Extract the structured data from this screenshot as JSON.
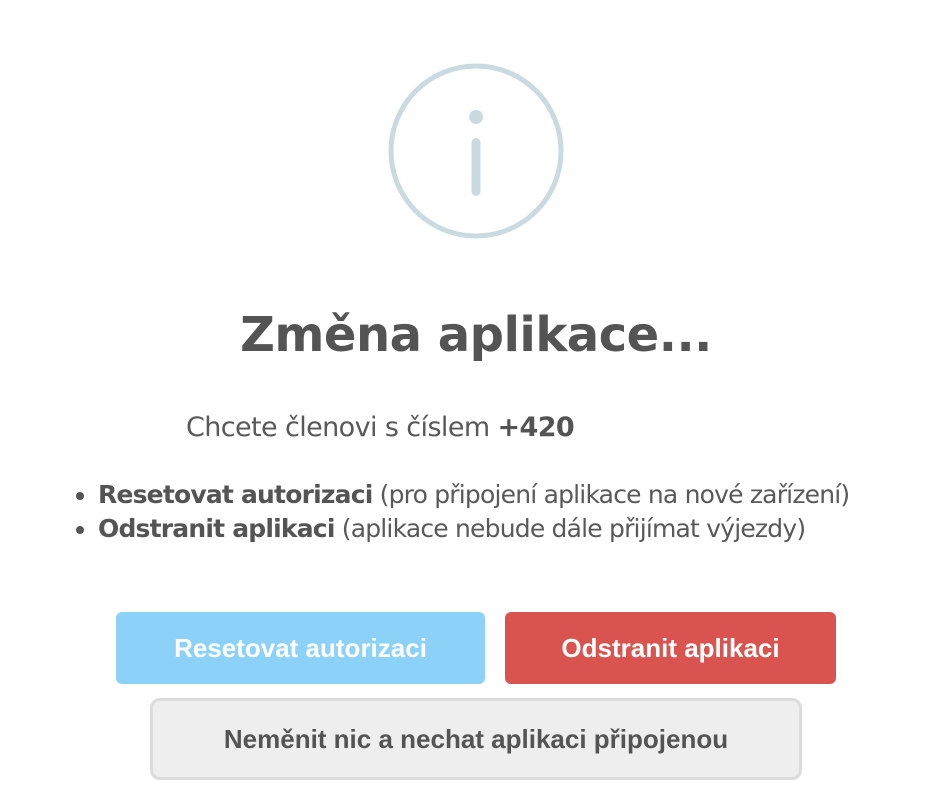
{
  "dialog": {
    "icon": "info-circle-icon",
    "icon_color": "#c9dae1",
    "title": "Změna aplikace...",
    "question_prefix": "Chcete členovi s číslem ",
    "question_phone": "+420",
    "options": [
      {
        "label": "Resetovat autorizaci",
        "description": " (pro připojení aplikace na nové zařízení)"
      },
      {
        "label": "Odstranit aplikaci",
        "description": " (aplikace nebude dále přijímat výjezdy)"
      }
    ]
  },
  "buttons": {
    "reset_label": "Resetovat autorizaci",
    "reset_color": "#8cd1f7",
    "remove_label": "Odstranit aplikaci",
    "remove_color": "#d9534f",
    "keep_label": "Neměnit nic a nechat aplikaci připojenou",
    "keep_color": "#eeeeee"
  }
}
